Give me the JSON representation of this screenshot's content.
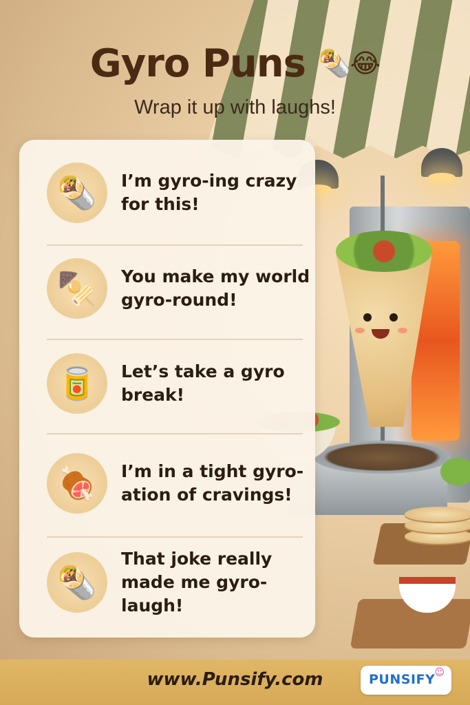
{
  "header": {
    "title": "Gyro Puns",
    "title_emojis": "🌯😂",
    "subtitle": "Wrap it up with laughs!"
  },
  "puns": [
    {
      "icon": "wrap-icon",
      "glyph": "🌯",
      "text": "I’m gyro-ing crazy for this!"
    },
    {
      "icon": "skewers-icon",
      "glyph": "🍢",
      "text": "You make my world gyro-round!"
    },
    {
      "icon": "sauce-bottles-icon",
      "glyph": "🥫",
      "text": "Let’s take a gyro break!"
    },
    {
      "icon": "rotating-meat-icon",
      "glyph": "🍖",
      "text": "I’m in a tight gyro-ation of cravings!"
    },
    {
      "icon": "smiling-wrap-icon",
      "glyph": "🌯",
      "text": "That joke really made me gyro-laugh!"
    }
  ],
  "footer": {
    "url": "www.Punsify.com",
    "logo_text": "PUNSIFY"
  },
  "colors": {
    "title": "#4a2a12",
    "footer_bg": "#d6a957",
    "card_bg": "#fbf4e8",
    "logo_text": "#1f6fd1"
  }
}
